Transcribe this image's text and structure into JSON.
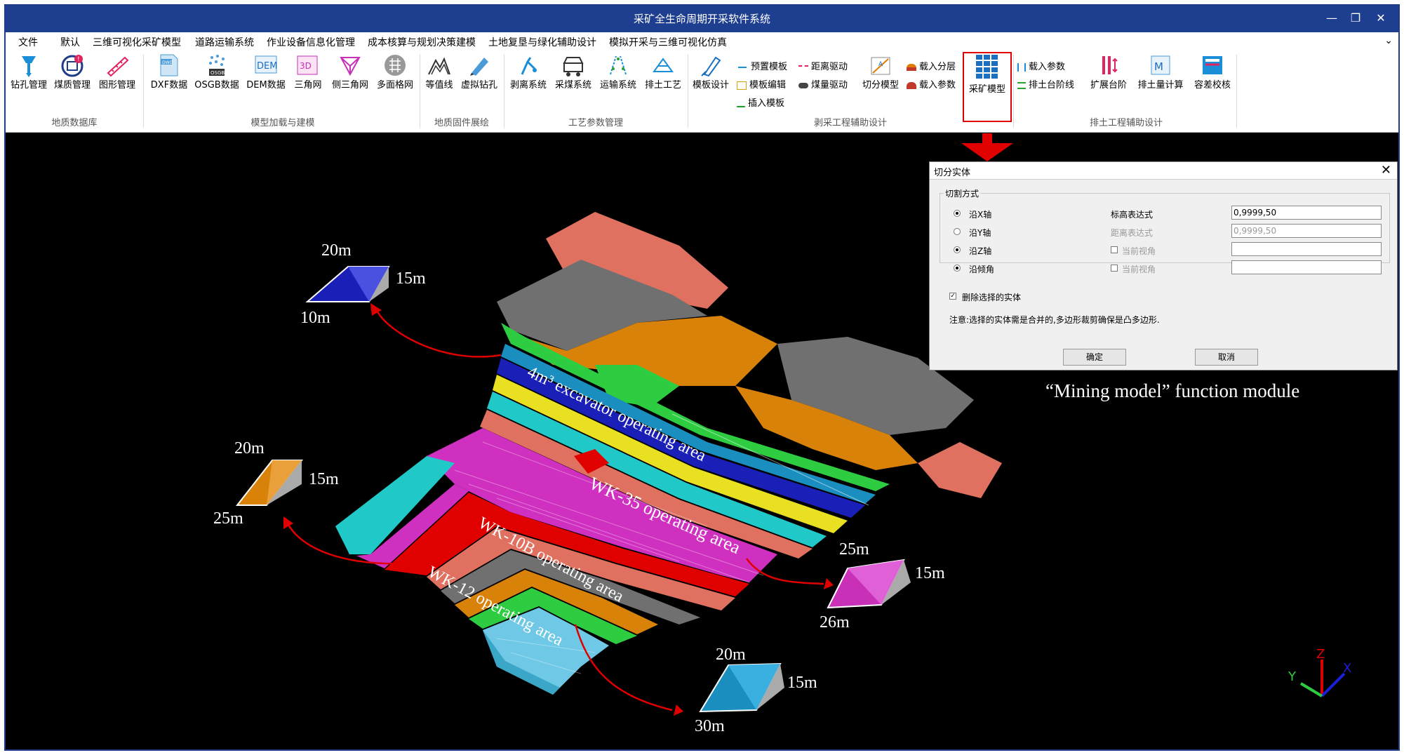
{
  "window": {
    "title": "采矿全生命周期开采软件系统",
    "controls": [
      "—",
      "❐",
      "✕"
    ]
  },
  "menu": [
    "文件",
    "默认",
    "三维可视化采矿模型",
    "道路运输系统",
    "作业设备信息化管理",
    "成本核算与规划决策建模",
    "土地复垦与绿化辅助设计",
    "模拟开采与三维可视化仿真"
  ],
  "ribbon": {
    "groups": [
      {
        "label": "地质数据库",
        "tools": [
          {
            "label": "钻孔管理",
            "icon": "drill-icon"
          },
          {
            "label": "煤质管理",
            "icon": "coal-quality-icon"
          },
          {
            "label": "图形管理",
            "icon": "graphics-icon"
          }
        ]
      },
      {
        "label": "模型加载与建模",
        "tools": [
          {
            "label": "DXF数据",
            "icon": "dwg-icon"
          },
          {
            "label": "OSGB数据",
            "icon": "osgb-icon"
          },
          {
            "label": "DEM数据",
            "icon": "dem-icon"
          },
          {
            "label": "三角网",
            "icon": "3d-triangle-icon"
          },
          {
            "label": "侧三角网",
            "icon": "side-triangle-icon"
          },
          {
            "label": "多面格网",
            "icon": "grid-icon"
          }
        ]
      },
      {
        "label": "地质固件展绘",
        "tools": [
          {
            "label": "等值线",
            "icon": "contour-icon"
          },
          {
            "label": "虚拟钻孔",
            "icon": "virtual-drill-icon"
          }
        ]
      },
      {
        "label": "工艺参数管理",
        "tools": [
          {
            "label": "剥离系统",
            "icon": "stripping-icon"
          },
          {
            "label": "采煤系统",
            "icon": "mining-icon"
          },
          {
            "label": "运输系统",
            "icon": "transport-icon"
          },
          {
            "label": "排土工艺",
            "icon": "dumping-icon"
          }
        ]
      },
      {
        "label": "剥采工程辅助设计",
        "tools": [
          {
            "label": "模板设计",
            "icon": "template-icon"
          },
          {
            "label": "切分模型",
            "icon": "split-model-icon"
          },
          {
            "label": "采矿模型",
            "icon": "mining-model-icon"
          }
        ],
        "small": [
          "预置模板",
          "模板编辑",
          "插入模板",
          "距离驱动",
          "煤量驱动",
          "载入分层",
          "载入参数"
        ]
      },
      {
        "label": "排土工程辅助设计",
        "tools": [
          {
            "label": "扩展台阶",
            "icon": "expand-bench-icon"
          },
          {
            "label": "排土量计算",
            "icon": "dump-volume-icon"
          },
          {
            "label": "容差校核",
            "icon": "tolerance-icon"
          }
        ],
        "small": [
          "载入参数",
          "排土台阶线"
        ]
      }
    ]
  },
  "dialog": {
    "title": "切分实体",
    "group_label": "切割方式",
    "options": [
      {
        "label": "沿X轴",
        "checked": true
      },
      {
        "label": "沿Y轴",
        "checked": false
      },
      {
        "label": "沿Z轴",
        "checked": true
      },
      {
        "label": "沿倾角",
        "checked": true
      }
    ],
    "field1_label": "标高表达式",
    "field1_value": "0,9999,50",
    "field2_label": "距离表达式",
    "field2_value": "0,9999,50",
    "check_view1": "当前视角",
    "check_view2": "当前视角",
    "delete_label": "删除选择的实体",
    "note": "注意:选择的实体需是合并的,多边形裁剪确保是凸多边形.",
    "ok": "确定",
    "cancel": "取消"
  },
  "caption": "“Mining model” function module",
  "areas": [
    "4m³ excavator operating area",
    "WK-35 operating area",
    "WK-10B operating area",
    "WK-12 operating area"
  ],
  "blocks": [
    {
      "top": "20m",
      "right": "15m",
      "bottom": "10m",
      "color": "#1a1fb8"
    },
    {
      "top": "20m",
      "right": "15m",
      "bottom": "25m",
      "color": "#d9820a"
    },
    {
      "top": "25m",
      "right": "15m",
      "bottom": "26m",
      "color": "#c830b8"
    },
    {
      "top": "20m",
      "right": "15m",
      "bottom": "30m",
      "color": "#1a8fbf"
    }
  ],
  "axes": {
    "x": "X",
    "y": "Y",
    "z": "Z"
  }
}
